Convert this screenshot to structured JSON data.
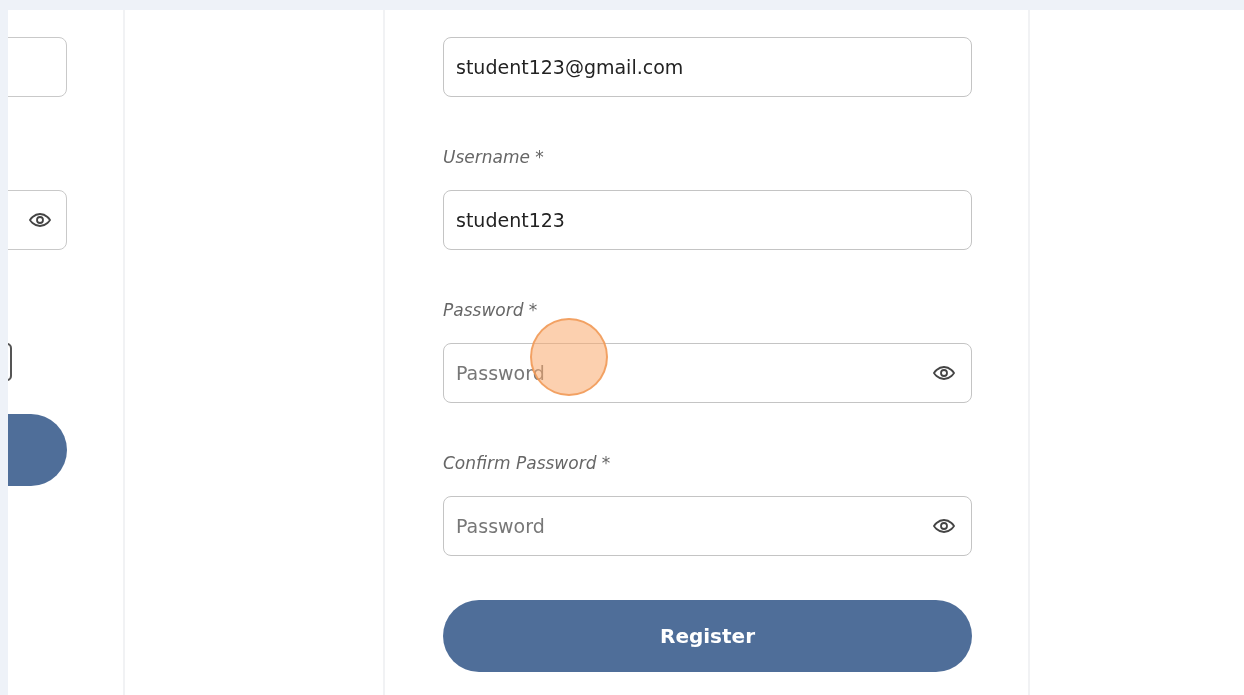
{
  "register_form": {
    "fields": [
      {
        "kind": "text",
        "value": "student123@gmail.com"
      },
      {
        "kind": "text",
        "label": "Username *",
        "value": "student123"
      },
      {
        "kind": "password",
        "label": "Password *",
        "placeholder": "Password"
      },
      {
        "kind": "password",
        "label": "Confirm Password *",
        "placeholder": "Password"
      }
    ],
    "submit": "Register"
  }
}
